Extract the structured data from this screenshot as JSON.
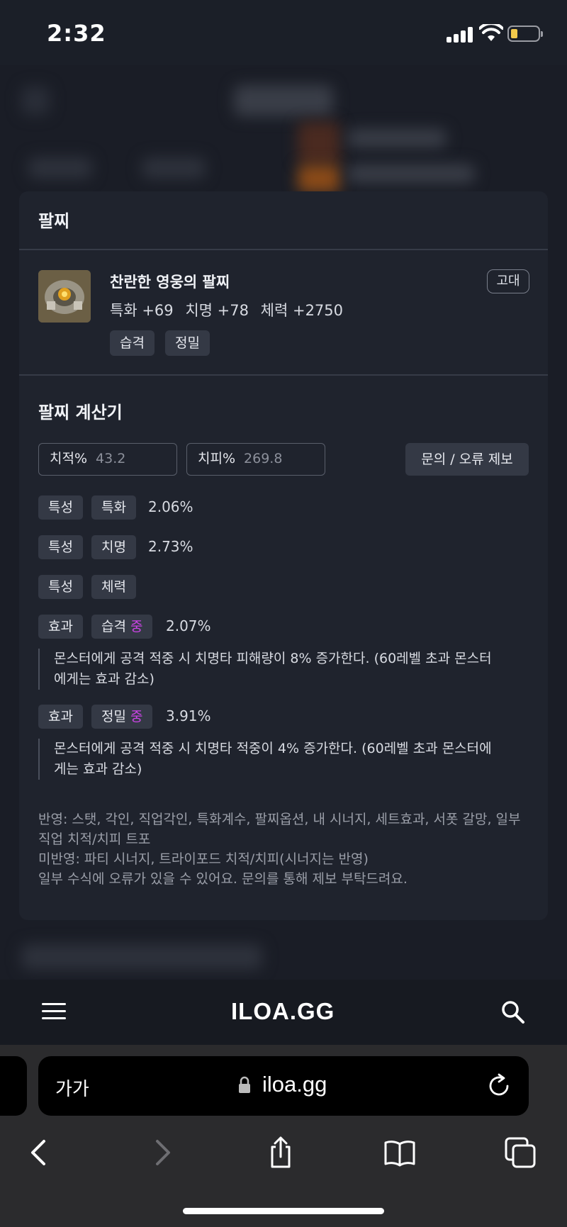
{
  "status_bar": {
    "time": "2:32"
  },
  "modal": {
    "title": "팔찌",
    "item": {
      "name": "찬란한 영웅의 팔찌",
      "grade": "고대",
      "stats": [
        "특화 +69",
        "치명 +78",
        "체력 +2750"
      ],
      "tags": [
        "습격",
        "정밀"
      ]
    },
    "calculator": {
      "title": "팔찌 계산기",
      "crit_rate_label": "치적%",
      "crit_rate_value": "43.2",
      "crit_damage_label": "치피%",
      "crit_damage_value": "269.8",
      "report_button": "문의 / 오류 제보",
      "rows": [
        {
          "type": "특성",
          "name": "특화",
          "value": "2.06%"
        },
        {
          "type": "특성",
          "name": "치명",
          "value": "2.73%"
        },
        {
          "type": "특성",
          "name": "체력",
          "value": ""
        }
      ],
      "effects": [
        {
          "type": "효과",
          "name": "습격",
          "grade": "중",
          "value": "2.07%",
          "description": "몬스터에게 공격 적중 시 치명타 피해량이 8% 증가한다. (60레벨 초과 몬스터에게는 효과 감소)"
        },
        {
          "type": "효과",
          "name": "정밀",
          "grade": "중",
          "value": "3.91%",
          "description": "몬스터에게 공격 적중 시 치명타 적중이 4% 증가한다. (60레벨 초과 몬스터에게는 효과 감소)"
        }
      ],
      "notes": [
        "반영: 스탯, 각인, 직업각인, 특화계수, 팔찌옵션, 내 시너지, 세트효과, 서폿 갈망, 일부 직업 치적/치피 트포",
        "미반영: 파티 시너지, 트라이포드 치적/치피(시너지는 반영)",
        "일부 수식에 오류가 있을 수 있어요. 문의를 통해 제보 부탁드려요."
      ]
    }
  },
  "site_header": {
    "logo": "ILOA.GG"
  },
  "browser": {
    "text_size_label": "가가",
    "url": "iloa.gg"
  },
  "icons": [
    "menu-icon",
    "search-icon",
    "lock-icon",
    "reload-icon",
    "back-icon",
    "forward-icon",
    "share-icon",
    "bookmarks-icon",
    "tabs-icon"
  ],
  "colors": {
    "accent_mid_grade": "#cc44e6",
    "modal_bg": "#1f232d",
    "chip_bg": "#343945"
  }
}
